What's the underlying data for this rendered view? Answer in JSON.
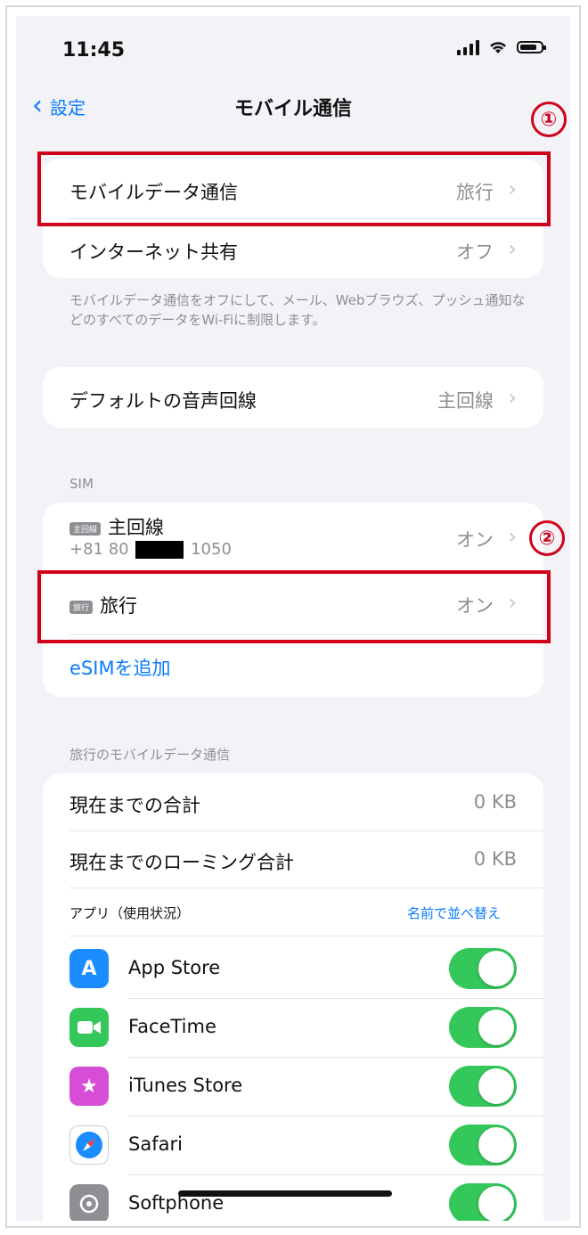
{
  "status_bar": {
    "time": "11:45"
  },
  "nav": {
    "back_label": "設定",
    "title": "モバイル通信"
  },
  "group1": {
    "rows": [
      {
        "label": "モバイルデータ通信",
        "value": "旅行"
      },
      {
        "label": "インターネット共有",
        "value": "オフ"
      }
    ],
    "footer": "モバイルデータ通信をオフにして、メール、Webブラウズ、プッシュ通知などのすべてのデータをWi-Fiに制限します。"
  },
  "group2": {
    "label": "デフォルトの音声回線",
    "value": "主回線"
  },
  "sim": {
    "header": "SIM",
    "primary": {
      "badge": "主回線",
      "label": "主回線",
      "number_prefix": "+81 80",
      "number_suffix": "1050",
      "value": "オン"
    },
    "travel": {
      "badge": "旅行",
      "label": "旅行",
      "value": "オン"
    },
    "add_esim": "eSIMを追加"
  },
  "usage": {
    "header": "旅行のモバイルデータ通信",
    "current_total_label": "現在までの合計",
    "current_total_value": "0 KB",
    "roaming_total_label": "現在までのローミング合計",
    "roaming_total_value": "0 KB",
    "apps_header": "アプリ（使用状況）",
    "sort_link": "名前で並べ替え",
    "apps": [
      {
        "name": "App Store",
        "icon": "app-store-icon",
        "color": "#1a8cff",
        "enabled": true
      },
      {
        "name": "FaceTime",
        "icon": "facetime-icon",
        "color": "#34c759",
        "enabled": true
      },
      {
        "name": "iTunes Store",
        "icon": "itunes-store-icon",
        "color": "#d64ed6",
        "enabled": true
      },
      {
        "name": "Safari",
        "icon": "safari-icon",
        "color": "#1a8cff",
        "enabled": true
      },
      {
        "name": "Softphone",
        "icon": "softphone-icon",
        "color": "#8e8e93",
        "enabled": true
      }
    ]
  },
  "annotations": {
    "one": "①",
    "two": "②"
  },
  "colors": {
    "accent": "#0a7aff",
    "toggle_on": "#34c759",
    "annotation": "#d0021b"
  }
}
